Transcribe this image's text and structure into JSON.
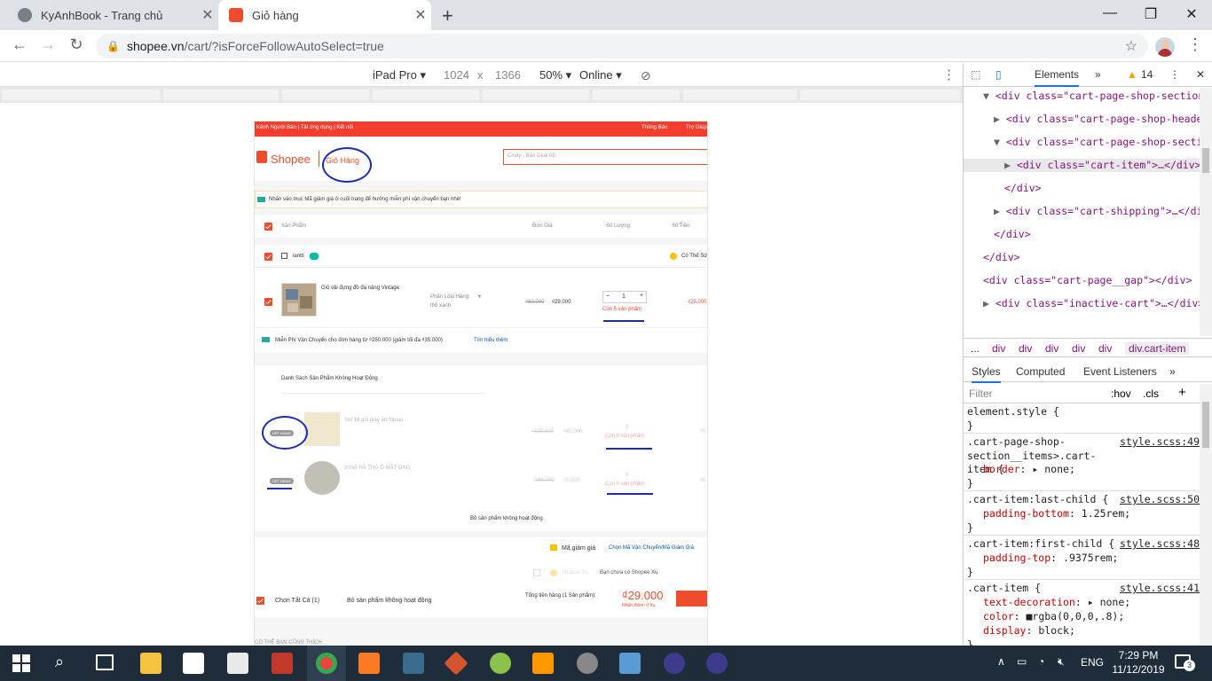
{
  "browser": {
    "tabs": [
      {
        "title": "KyAnhBook - Trang chủ",
        "active": false
      },
      {
        "title": "Giỏ hàng",
        "active": true
      }
    ],
    "url_host": "shopee.vn",
    "url_path": "/cart/?isForceFollowAutoSelect=true"
  },
  "device_toolbar": {
    "device": "iPad Pro",
    "width": "1024",
    "x": "x",
    "height": "1366",
    "zoom": "50%",
    "network": "Online"
  },
  "page": {
    "topbar_left": "Kênh Người Bán  |  Tải ứng dụng  |  Kết nối",
    "topbar_notify": "Thông Báo",
    "topbar_help": "Trợ Giúp",
    "logo": "Shopee",
    "cart_title": "Giỏ Hàng",
    "search_placeholder": "Cindy - Bão Deal 0Đ",
    "notice": "Nhấn vào mục Mã giảm giá ở cuối trang để hưởng miễn phí vận chuyển bạn nhé!",
    "headers": {
      "product": "Sản Phẩm",
      "unit_price": "Đơn Giá",
      "qty": "Số Lượng",
      "total": "Số Tiền"
    },
    "shop_name": "lanttl",
    "shop_coupon": "Có Thể Sử",
    "item": {
      "name": "Giỏ vải đựng đồ đa năng Vintage",
      "variant_label": "Phân Loại Hàng:",
      "variant_value": "thỏ xanh",
      "old_price": "₫80.000",
      "price": "₫29.000",
      "qty": "1",
      "stock": "Còn 5 sản phẩm",
      "total": "₫29.000"
    },
    "shipping_note": "Miễn Phí Vận Chuyển cho đơn hàng từ ₫250.000 (giảm tối đa ₫35.000)",
    "shipping_link": "Tìm hiểu thêm",
    "inactive_title": "Danh Sách Sản Phẩm Không Hoạt Động",
    "inactive_items": [
      {
        "badge": "HẾT HÀNG",
        "name": "Set 18 gói giấy ăn Sipiao",
        "old_price": "₫129.000",
        "price": "₫65.000",
        "qty": "0",
        "stock": "Còn 0 sản phẩm",
        "total": "₫0"
      },
      {
        "badge": "HẾT HÀNG",
        "name": "200G HÀ THỦ Ô MẬT ONG",
        "old_price": "₫89.000",
        "price": "₫1.000",
        "qty": "0",
        "stock": "Còn 0 sản phẩm",
        "total": "₫0"
      }
    ],
    "remove_inactive": "Bỏ sản phẩm không hoạt động",
    "voucher_label": "Mã giảm giá",
    "voucher_input": "Chọn Mã Vận Chuyển/Mã Giảm Giá",
    "xu_label": "Shopee Xu",
    "xu_note": "Bạn chưa có Shopee Xu",
    "select_all": "Chọn Tất Cả (1)",
    "remove_inactive_bottom": "Bỏ sản phẩm không hoạt động",
    "total_label": "Tổng tiền hàng (1 Sản phẩm):",
    "total_value": "₫29.000",
    "xu_earn": "Nhận thêm: 0 Xu",
    "below": "CÓ THỂ BẠN CŨNG THÍCH"
  },
  "devtools": {
    "elements_tab": "Elements",
    "warnings": "14",
    "dom": [
      {
        "indent": 1,
        "arrow": "▼",
        "text": "<div class=\"cart-page-shop-section\">"
      },
      {
        "indent": 2,
        "arrow": "▶",
        "text": "<div class=\"cart-page-shop-header\">…</div>"
      },
      {
        "indent": 2,
        "arrow": "▼",
        "text": "<div class=\"cart-page-shop-section__items\">"
      },
      {
        "indent": 3,
        "arrow": "▶",
        "text": "<div class=\"cart-item\">…</div> == $0",
        "selected": true
      },
      {
        "indent": 3,
        "arrow": "",
        "text": "</div>"
      },
      {
        "indent": 2,
        "arrow": "▶",
        "text": "<div class=\"cart-shipping\">…</div>"
      },
      {
        "indent": 2,
        "arrow": "",
        "text": "</div>"
      },
      {
        "indent": 1,
        "arrow": "",
        "text": "</div>"
      },
      {
        "indent": 1,
        "arrow": "",
        "text": "<div class=\"cart-page__gap\"></div>"
      },
      {
        "indent": 1,
        "arrow": "▶",
        "text": "<div class=\"inactive-cart\">…</div>"
      }
    ],
    "breadcrumbs": [
      "...",
      "div",
      "div",
      "div",
      "div",
      "div",
      "div.cart-item"
    ],
    "styles_tabs": [
      "Styles",
      "Computed",
      "Event Listeners",
      "»"
    ],
    "filter_placeholder": "Filter",
    "hov": ":hov",
    "cls": ".cls",
    "rules": [
      {
        "selector": "element.style {",
        "source": "",
        "decls": []
      },
      {
        "selector": ".cart-page-shop-section__items>.cart-item {",
        "source": "style.scss:49",
        "decls": [
          [
            "border",
            "▸ none;"
          ]
        ]
      },
      {
        "selector": ".cart-item:last-child {",
        "source": "style.scss:50",
        "decls": [
          [
            "padding-bottom",
            "1.25rem;"
          ]
        ]
      },
      {
        "selector": ".cart-item:first-child {",
        "source": "style.scss:48",
        "decls": [
          [
            "padding-top",
            ".9375rem;"
          ]
        ]
      },
      {
        "selector": ".cart-item {",
        "source": "style.scss:41",
        "decls": [
          [
            "text-decoration",
            "▸ none;"
          ],
          [
            "color",
            "■rgba(0,0,0,.8);"
          ],
          [
            "display",
            "block;"
          ]
        ]
      }
    ]
  },
  "taskbar": {
    "lang": "ENG",
    "time": "7:29 PM",
    "date": "11/12/2019",
    "notifications": "3"
  }
}
